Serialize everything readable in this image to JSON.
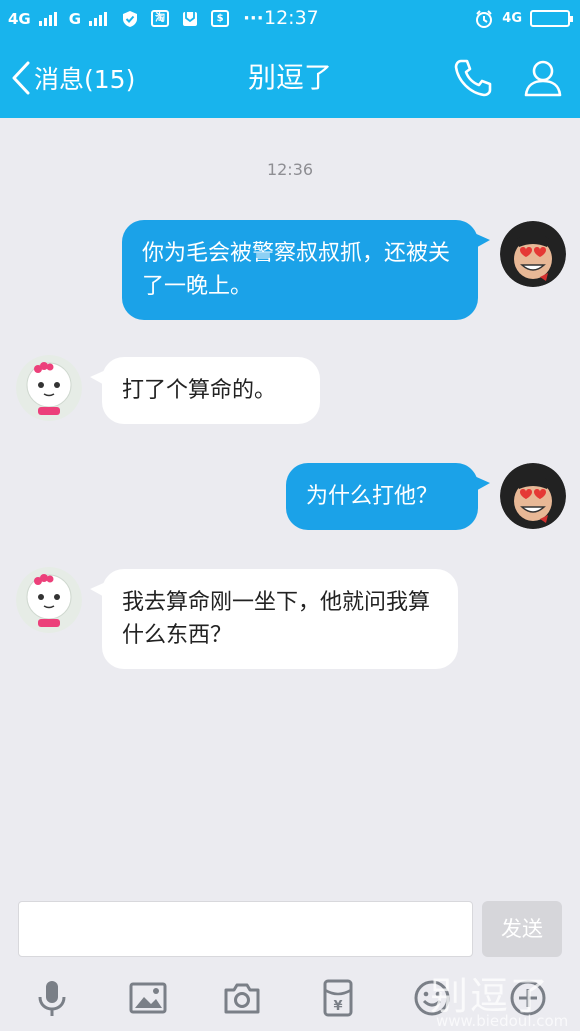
{
  "status_bar": {
    "network1": "4G",
    "network2": "G",
    "shop_icon_text": "淘",
    "dots": "···",
    "time": "12:37",
    "network_right": "4G"
  },
  "nav": {
    "back_label": "消息(15)",
    "title": "别逗了"
  },
  "chat": {
    "timestamp": "12:36",
    "messages": [
      {
        "sender": "me",
        "text": "你为毛会被警察叔叔抓，还被关了一晚上。"
      },
      {
        "sender": "them",
        "text": "打了个算命的。"
      },
      {
        "sender": "me",
        "text": "为什么打他？"
      },
      {
        "sender": "them",
        "text": "我去算命刚一坐下，他就问我算什么东西？"
      }
    ]
  },
  "input_bar": {
    "send_label": "发送",
    "tools": [
      "microphone-icon",
      "image-icon",
      "camera-icon",
      "red-packet-icon",
      "emoji-icon",
      "plus-icon"
    ]
  },
  "watermark": {
    "text": "别逗了",
    "url": "www.biedoul.com"
  },
  "colors": {
    "header": "#18b4ed",
    "my_bubble": "#1ba2e8",
    "their_bubble": "#ffffff",
    "background": "#ebebf0"
  }
}
